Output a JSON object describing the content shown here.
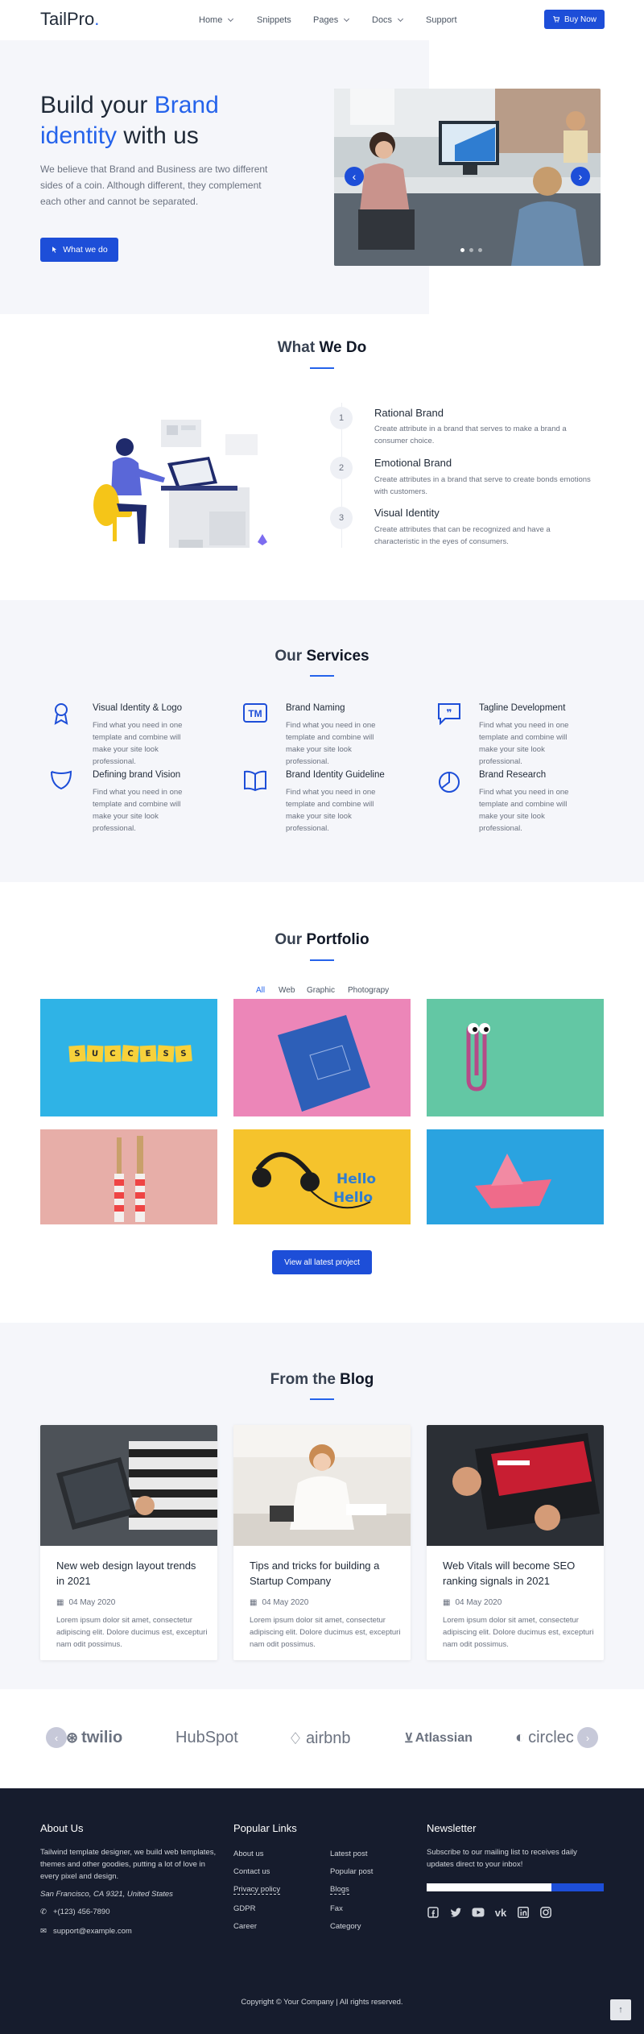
{
  "header": {
    "logo_main": "TailPro",
    "logo_dot": ".",
    "nav": [
      {
        "label": "Home",
        "dropdown": true
      },
      {
        "label": "Snippets",
        "dropdown": false
      },
      {
        "label": "Pages",
        "dropdown": true
      },
      {
        "label": "Docs",
        "dropdown": true
      },
      {
        "label": "Support",
        "dropdown": false
      }
    ],
    "buy_label": "Buy Now"
  },
  "hero": {
    "title_part1": "Build your ",
    "title_highlight1": "Brand",
    "title_highlight2": "identity",
    "title_part2": " with us",
    "description": "We believe that Brand and Business are two different sides of a coin. Although different, they complement each other and cannot be separated.",
    "cta_label": "What we do",
    "slider_prev": "‹",
    "slider_next": "›",
    "slider_dots": 3
  },
  "what_we_do": {
    "title_light": "What ",
    "title_bold": "We Do",
    "steps": [
      {
        "num": "1",
        "title": "Rational Brand",
        "desc": "Create attribute in a brand that serves to make a brand a consumer choice."
      },
      {
        "num": "2",
        "title": "Emotional Brand",
        "desc": "Create attributes in a brand that serve to create bonds emotions with customers."
      },
      {
        "num": "3",
        "title": "Visual Identity",
        "desc": "Create attributes that can be recognized and have a characteristic in the eyes of consumers."
      }
    ]
  },
  "services": {
    "title_light": "Our ",
    "title_bold": "Services",
    "items": [
      {
        "icon": "award-icon",
        "title": "Visual Identity & Logo",
        "desc": "Find what you need in one template and combine will make your site look professional."
      },
      {
        "icon": "tm-icon",
        "title": "Brand Naming",
        "desc": "Find what you need in one template and combine will make your site look professional."
      },
      {
        "icon": "quote-icon",
        "title": "Tagline Development",
        "desc": "Find what you need in one template and combine will make your site look professional."
      },
      {
        "icon": "shield-icon",
        "title": "Defining brand Vision",
        "desc": "Find what you need in one template and combine will make your site look professional."
      },
      {
        "icon": "book-icon",
        "title": "Brand Identity Guideline",
        "desc": "Find what you need in one template and combine will make your site look professional."
      },
      {
        "icon": "pie-chart-icon",
        "title": "Brand Research",
        "desc": "Find what you need in one template and combine will make your site look professional."
      }
    ]
  },
  "portfolio": {
    "title_light": "Our ",
    "title_bold": "Portfolio",
    "filters": [
      "All",
      "Web",
      "Graphic",
      "Photograpy"
    ],
    "active_filter": "All",
    "success_letters": [
      "S",
      "U",
      "C",
      "C",
      "E",
      "S",
      "S"
    ],
    "hello_text": "Hello",
    "button_label": "View all latest project"
  },
  "blog": {
    "title_light": "From the ",
    "title_bold": "Blog",
    "posts": [
      {
        "title": "New web design layout trends in 2021",
        "date": "04 May 2020",
        "excerpt": "Lorem ipsum dolor sit amet, consectetur adipiscing elit. Dolore ducimus est, excepturi nam odit possimus."
      },
      {
        "title": "Tips and tricks for building a Startup Company",
        "date": "04 May 2020",
        "excerpt": "Lorem ipsum dolor sit amet, consectetur adipiscing elit. Dolore ducimus est, excepturi nam odit possimus."
      },
      {
        "title": "Web Vitals will become SEO ranking signals in 2021",
        "date": "04 May 2020",
        "excerpt": "Lorem ipsum dolor sit amet, consectetur adipiscing elit. Dolore ducimus est, excepturi nam odit possimus."
      }
    ]
  },
  "clients": {
    "logos": [
      "twilio",
      "HubSpot",
      "airbnb",
      "Atlassian",
      "circlec"
    ],
    "prev": "‹",
    "next": "›"
  },
  "footer": {
    "about_title": "About Us",
    "about_text": "Tailwind template designer, we build web templates, themes and other goodies, putting a lot of love in every pixel and design.",
    "address": "San Francisco, CA 9321, United States",
    "phone": "+(123) 456-7890",
    "email": "support@example.com",
    "links_title": "Popular Links",
    "links_col1": [
      "About us",
      "Contact us",
      "Privacy policy",
      "GDPR",
      "Career"
    ],
    "links_col2": [
      "Latest post",
      "Popular post",
      "Blogs",
      "Fax",
      "Category"
    ],
    "newsletter_title": "Newsletter",
    "newsletter_text": "Subscribe to our mailing list to receives daily updates direct to your inbox!",
    "social": [
      "facebook-icon",
      "twitter-icon",
      "youtube-icon",
      "vk-icon",
      "linkedin-icon",
      "instagram-icon"
    ],
    "copyright": "Copyright © Your Company | All rights reserved.",
    "back_to_top": "↑"
  },
  "colors": {
    "primary": "#1d4ed8",
    "accent": "#2563eb",
    "footer_bg": "#161c2d",
    "section_bg": "#f5f6fa"
  }
}
